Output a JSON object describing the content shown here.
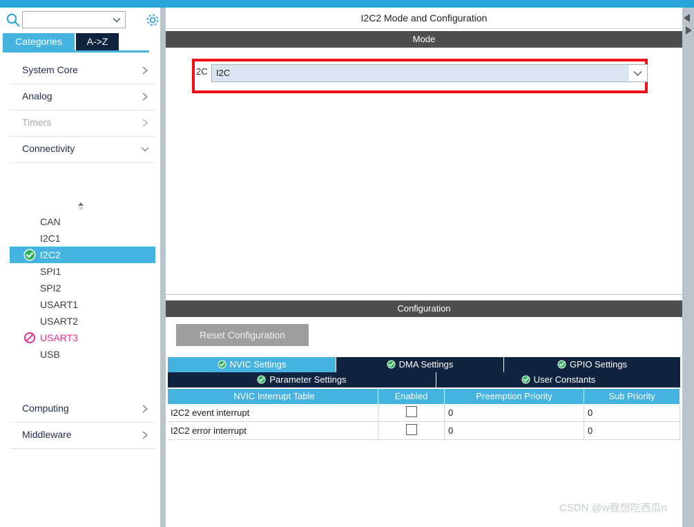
{
  "window": {
    "top_strip_color": "#29a4da"
  },
  "sidebar": {
    "search": {
      "value": "",
      "placeholder": "",
      "icon": "search-icon",
      "chevron_icon": "chevron-down-icon"
    },
    "settings_icon": "gear-icon",
    "tabs": [
      {
        "label": "Categories",
        "active": true
      },
      {
        "label": "A->Z",
        "active": false
      }
    ],
    "categories_upper": [
      {
        "label": "System Core",
        "expanded": false,
        "disabled": false,
        "arrow": "chevron-right-icon"
      },
      {
        "label": "Analog",
        "expanded": false,
        "disabled": false,
        "arrow": "chevron-right-icon"
      },
      {
        "label": "Timers",
        "expanded": false,
        "disabled": true,
        "arrow": "chevron-right-icon"
      },
      {
        "label": "Connectivity",
        "expanded": true,
        "disabled": false,
        "arrow": "chevron-down-icon"
      }
    ],
    "sort_handle_icon": "sort-updown-icon",
    "peripherals": [
      {
        "label": "CAN",
        "state": "none",
        "selected": false
      },
      {
        "label": "I2C1",
        "state": "none",
        "selected": false
      },
      {
        "label": "I2C2",
        "state": "configured",
        "selected": true,
        "icon": "check-circle-icon"
      },
      {
        "label": "SPI1",
        "state": "none",
        "selected": false
      },
      {
        "label": "SPI2",
        "state": "none",
        "selected": false
      },
      {
        "label": "USART1",
        "state": "none",
        "selected": false
      },
      {
        "label": "USART2",
        "state": "none",
        "selected": false
      },
      {
        "label": "USART3",
        "state": "unavailable",
        "selected": false,
        "icon": "no-entry-icon"
      },
      {
        "label": "USB",
        "state": "none",
        "selected": false
      }
    ],
    "categories_lower": [
      {
        "label": "Computing",
        "expanded": false,
        "disabled": false,
        "arrow": "chevron-right-icon"
      },
      {
        "label": "Middleware",
        "expanded": false,
        "disabled": false,
        "arrow": "chevron-right-icon"
      }
    ]
  },
  "main": {
    "title": "I2C2 Mode and Configuration",
    "mode_section": {
      "header": "Mode",
      "field_label": "2C",
      "combo_value": "I2C",
      "combo_chevron": "chevron-down-icon",
      "highlight_color": "#ef0f13"
    },
    "config_section": {
      "header": "Configuration",
      "reset_button": "Reset Configuration",
      "tabs_row1": [
        {
          "label": "NVIC Settings",
          "active": true,
          "icon": "check-circle-icon"
        },
        {
          "label": "DMA Settings",
          "active": false,
          "icon": "check-circle-icon"
        },
        {
          "label": "GPIO Settings",
          "active": false,
          "icon": "check-circle-icon"
        }
      ],
      "tabs_row2": [
        {
          "label": "Parameter Settings",
          "active": false,
          "icon": "check-circle-icon"
        },
        {
          "label": "User Constants",
          "active": false,
          "icon": "check-circle-icon"
        }
      ],
      "nvic_table": {
        "columns": [
          "NVIC Interrupt Table",
          "Enabled",
          "Preemption Priority",
          "Sub Priority"
        ],
        "rows": [
          {
            "name": "I2C2 event interrupt",
            "enabled": false,
            "preemption": "0",
            "sub": "0"
          },
          {
            "name": "I2C2 error interrupt",
            "enabled": false,
            "preemption": "0",
            "sub": "0"
          }
        ]
      }
    },
    "edge_arrows": {
      "left": "triangle-left-icon",
      "right": "triangle-right-icon"
    }
  },
  "watermark": "CSDN @w我想吃西瓜n"
}
